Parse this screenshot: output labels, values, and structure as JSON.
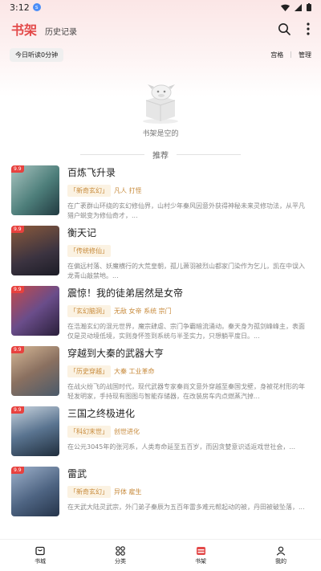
{
  "status": {
    "time": "3:12",
    "notif_badge": "s"
  },
  "header": {
    "tab_active": "书架",
    "tab_history": "历史记录"
  },
  "subbar": {
    "today": "今日听读0分钟",
    "grid": "宫格",
    "manage": "管理"
  },
  "empty": {
    "text": "书架是空的"
  },
  "recommend": {
    "label": "推荐"
  },
  "books": [
    {
      "score": "9.9",
      "title": "百炼飞升录",
      "tag_main": "「新奇玄幻」",
      "tags": "凡人 打怪",
      "desc": "在广袤群山环绕的玄幻修仙界，山村少年秦风因意外获得神秘未来灵修功法，从平凡猎户蜕变为修仙奇才，...",
      "colors": [
        "#9bb7b3",
        "#3e6e6a"
      ]
    },
    {
      "score": "9.9",
      "title": "衡天记",
      "tag_main": "「传统修仙」",
      "tags": "",
      "desc": "在偏远村落、妖魔横行的大荒皇朝，孤儿萧羽被烈山都家门染作为乞儿，凯在中误入龙青山敲禁地。...",
      "colors": [
        "#7d4a34",
        "#2c2c3a"
      ]
    },
    {
      "score": "9.9",
      "title": "震惊！我的徒弟居然是女帝",
      "tag_main": "「玄幻脑洞」",
      "tags": "无敌 女帝 系统 宗门",
      "desc": "在浩瀚玄幻的混元世界，魔宗肆虐、宗门争霸暗流涌动。秦天身为孤剑峰峰主，表面仅是灵动境低境，实则身怀签到系统与半圣实力，只想躺平度日。...",
      "colors": [
        "#6a4d8a",
        "#c43b3b"
      ]
    },
    {
      "score": "9.9",
      "title": "穿越到大秦的武器大亨",
      "tag_main": "「历史穿越」",
      "tags": "大秦 工业革命",
      "desc": "在战火纷飞的战国时代，现代武器专家秦尚文意外穿越至秦国戈壁，身被花村形的年轻发明家，手持现有图图与智能存储器，在改装房车内点燃蒸汽掉...",
      "colors": [
        "#b08a6a",
        "#5a6a7a"
      ]
    },
    {
      "score": "9.9",
      "title": "三国之终极进化",
      "tag_main": "「科幻末世」",
      "tags": "创世进化",
      "desc": "在公元3045年的张河系，人类寿命延至五百岁，而因贪婪意识适返戏世社会，...",
      "colors": [
        "#3f5a72",
        "#c6d2dc"
      ]
    },
    {
      "score": "9.9",
      "title": "雷武",
      "tag_main": "「新奇玄幻」",
      "tags": "异体 雇生",
      "desc": "在天武大陆灵武宗，外门弟子秦辰为五百年雷多难元帮起动的被，丹田被破坠落，...",
      "colors": [
        "#6f86a8",
        "#2c3e56"
      ]
    }
  ],
  "nav": {
    "bookstore": "书城",
    "category": "分类",
    "shelf": "书架",
    "mine": "我的"
  },
  "theme": {
    "accent": "#e34a4a",
    "tag_color": "#c78a3b"
  }
}
